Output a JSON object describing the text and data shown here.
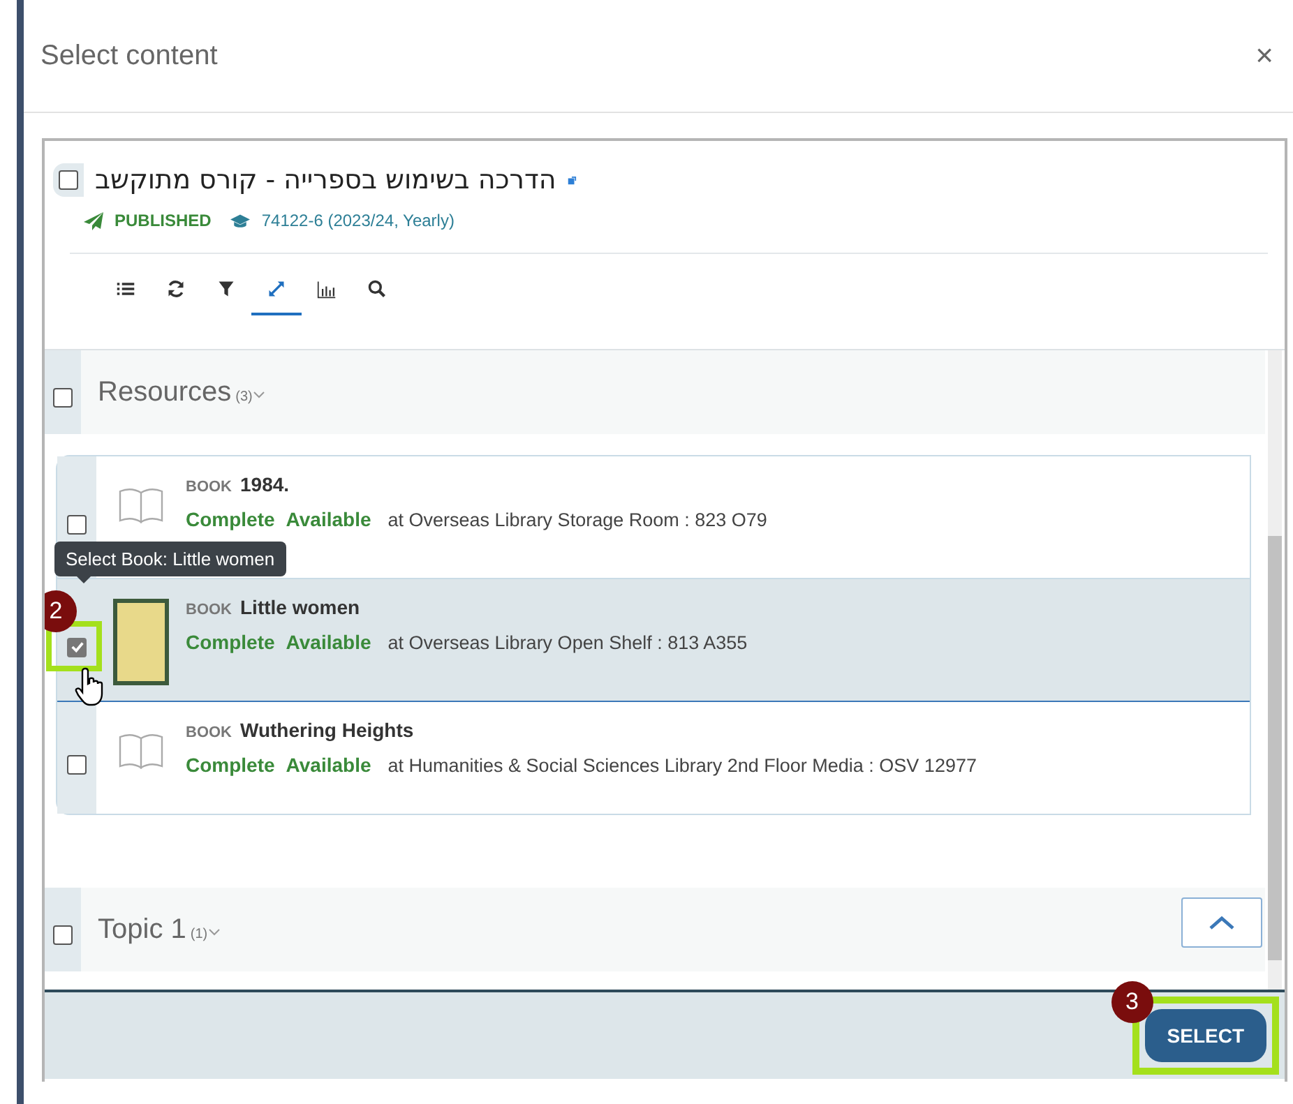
{
  "dialog": {
    "title": "Select content",
    "close": "×"
  },
  "course": {
    "checked": false,
    "title": "הדרכה בשימוש בספרייה - קורס מתוקשב",
    "status": "PUBLISHED",
    "code": "74122-6 (2023/24, Yearly)"
  },
  "toolbar": [
    {
      "kind": "list",
      "selected": false
    },
    {
      "kind": "refresh",
      "selected": false
    },
    {
      "kind": "filter",
      "selected": false
    },
    {
      "kind": "expand",
      "selected": true
    },
    {
      "kind": "chart",
      "selected": false
    },
    {
      "kind": "search",
      "selected": false
    }
  ],
  "sections": [
    {
      "title": "Resources",
      "count": "(3)",
      "checked": false,
      "items": [
        {
          "type": "BOOK",
          "title": "1984.",
          "statuses": [
            "Complete",
            "Available"
          ],
          "location": "at Overseas Library Storage Room : 823 O79",
          "checked": false,
          "selected": false,
          "cover": false
        },
        {
          "type": "BOOK",
          "title": "Little women",
          "statuses": [
            "Complete",
            "Available"
          ],
          "location": "at Overseas Library Open Shelf : 813 A355",
          "checked": true,
          "selected": true,
          "cover": true,
          "step": "2",
          "tooltip": "Select Book: Little women"
        },
        {
          "type": "BOOK",
          "title": "Wuthering Heights",
          "statuses": [
            "Complete",
            "Available"
          ],
          "location": "at Humanities & Social Sciences Library 2nd Floor Media : OSV 12977",
          "checked": false,
          "selected": false,
          "cover": false
        }
      ]
    },
    {
      "title": "Topic 1",
      "count": "(1)",
      "checked": false
    }
  ],
  "footer": {
    "button": "SELECT",
    "step": "3"
  }
}
